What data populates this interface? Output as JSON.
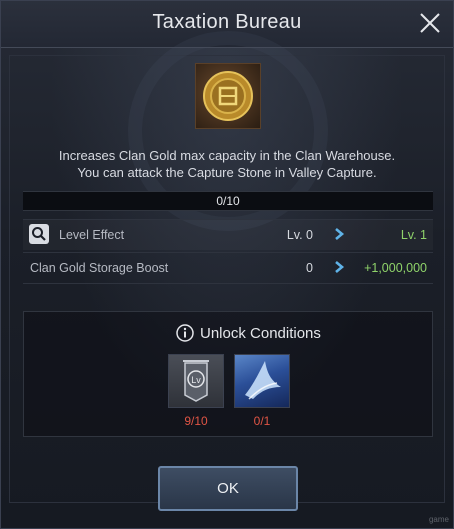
{
  "dialog": {
    "title": "Taxation Bureau",
    "close_icon": "close-icon"
  },
  "item": {
    "icon": "gold-medal-icon",
    "description_line1": "Increases Clan Gold max capacity in the Clan Warehouse.",
    "description_line2": "You can attack the Capture Stone in Valley Capture."
  },
  "progress": {
    "text": "0/10",
    "fraction": 0
  },
  "stats": [
    {
      "label": "Level Effect",
      "current": "Lv. 0",
      "next": "Lv. 1",
      "icon": "magnifier-icon"
    },
    {
      "label": "Clan Gold Storage Boost",
      "current": "0",
      "next": "+1,000,000"
    }
  ],
  "unlock": {
    "title": "Unlock Conditions",
    "icon": "info-icon",
    "conditions": [
      {
        "icon": "level-banner-icon",
        "count": "9/10"
      },
      {
        "icon": "wing-skill-icon",
        "count": "0/1"
      }
    ]
  },
  "ok_button": {
    "label": "OK"
  },
  "watermark": "game",
  "colors": {
    "accent_green": "#8fd36a",
    "requirement_red": "#e05545",
    "button_border": "#6b86a8"
  }
}
